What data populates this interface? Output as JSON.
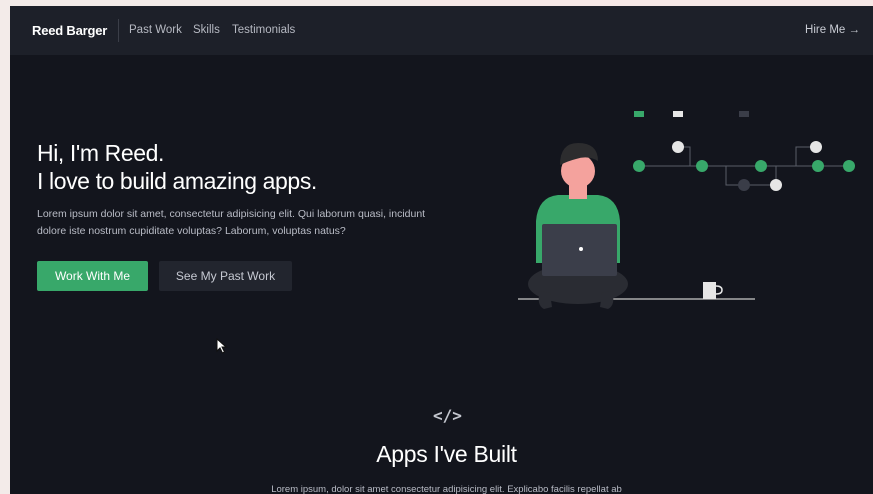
{
  "nav": {
    "brand": "Reed Barger",
    "links": [
      "Past Work",
      "Skills",
      "Testimonials"
    ],
    "cta": "Hire Me →"
  },
  "hero": {
    "heading_line1": "Hi, I'm Reed.",
    "heading_line2": "I love to build amazing apps.",
    "text": "Lorem ipsum dolor sit amet, consectetur adipisicing elit. Qui laborum quasi, incidunt dolore iste nostrum cupiditate voluptas? Laborum, voluptas natus?",
    "primary_button": "Work With Me",
    "secondary_button": "See My Past Work"
  },
  "apps_section": {
    "icon": "code-icon",
    "icon_glyph": "</>",
    "title": "Apps I've Built",
    "text": "Lorem ipsum, dolor sit amet consectetur adipisicing elit. Explicabo facilis repellat ab"
  },
  "colors": {
    "accent": "#38a86a",
    "background": "#13151d",
    "navbar": "#1d2029"
  }
}
